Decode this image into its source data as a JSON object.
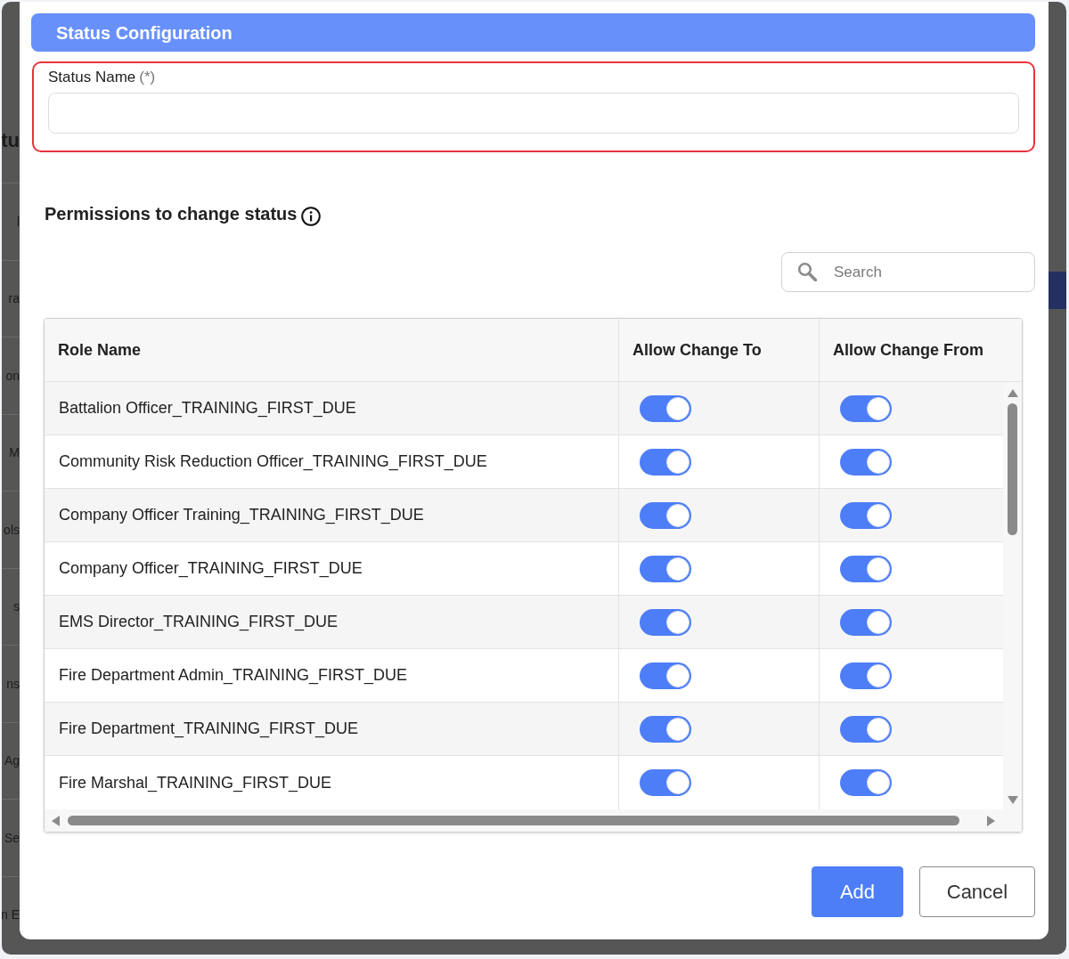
{
  "background_page": {
    "heading_fragment": "tu",
    "row_fragments": [
      "l",
      "ra",
      "on",
      "M",
      "ols",
      "s",
      "ns",
      "Ag",
      "Se",
      "n E"
    ]
  },
  "dialog": {
    "title": "Status Configuration",
    "status_name": {
      "label": "Status Name",
      "required_mark": "(*)",
      "invalid": true
    },
    "permissions": {
      "heading": "Permissions to change status"
    },
    "search": {
      "placeholder": "Search"
    },
    "table": {
      "columns": [
        "Role Name",
        "Allow Change To",
        "Allow Change From"
      ],
      "rows": [
        {
          "role": "Battalion Officer_TRAINING_FIRST_DUE",
          "allow_change_to": true,
          "allow_change_from": true
        },
        {
          "role": "Community Risk Reduction Officer_TRAINING_FIRST_DUE",
          "allow_change_to": true,
          "allow_change_from": true
        },
        {
          "role": "Company Officer Training_TRAINING_FIRST_DUE",
          "allow_change_to": true,
          "allow_change_from": true
        },
        {
          "role": "Company Officer_TRAINING_FIRST_DUE",
          "allow_change_to": true,
          "allow_change_from": true
        },
        {
          "role": "EMS Director_TRAINING_FIRST_DUE",
          "allow_change_to": true,
          "allow_change_from": true
        },
        {
          "role": "Fire Department Admin_TRAINING_FIRST_DUE",
          "allow_change_to": true,
          "allow_change_from": true
        },
        {
          "role": "Fire Department_TRAINING_FIRST_DUE",
          "allow_change_to": true,
          "allow_change_from": true
        },
        {
          "role": "Fire Marshal_TRAINING_FIRST_DUE",
          "allow_change_to": true,
          "allow_change_from": true
        }
      ]
    },
    "buttons": [
      {
        "label": "Add",
        "kind": "primary"
      },
      {
        "label": "Cancel",
        "kind": "secondary"
      }
    ]
  }
}
